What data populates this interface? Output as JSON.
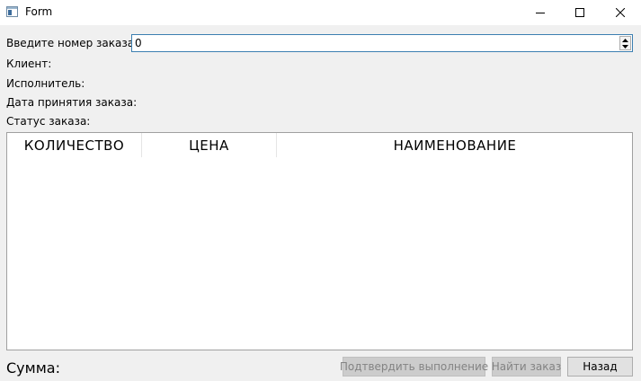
{
  "window": {
    "title": "Form",
    "controls": [
      "minimize",
      "maximize",
      "close"
    ]
  },
  "form": {
    "order_number_label": "Введите номер заказа",
    "order_number_value": "0",
    "client_label": "Клиент:",
    "executor_label": "Исполнитель:",
    "date_label": "Дата принятия заказа:",
    "status_label": "Статус заказа:"
  },
  "table": {
    "columns": [
      "КОЛИЧЕСТВО",
      "ЦЕНА",
      "НАИМЕНОВАНИЕ"
    ],
    "rows": []
  },
  "footer": {
    "sum_label": "Сумма:",
    "confirm_button": "Подтвердить выполнение",
    "find_button": "Найти заказ",
    "back_button": "Назад"
  },
  "colors": {
    "background": "#f0f0f0",
    "spin_border_focus": "#3c7fb1",
    "disabled_button": "#cccccc"
  }
}
